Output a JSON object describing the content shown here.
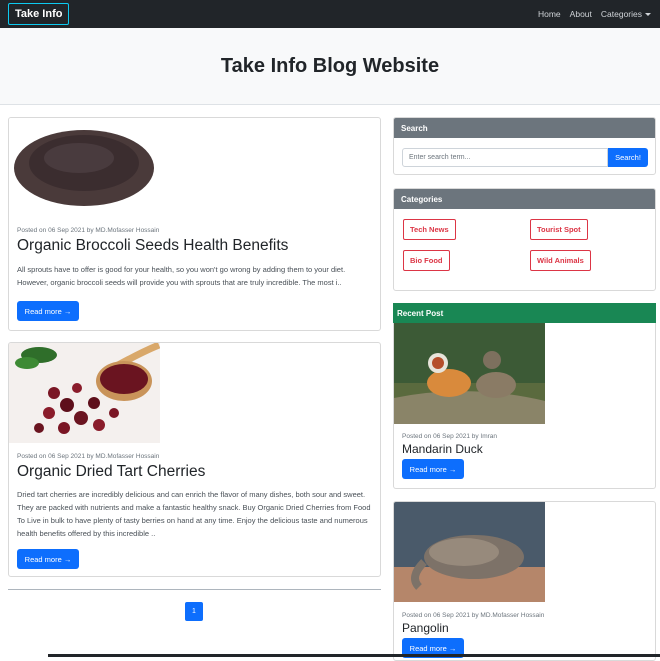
{
  "nav": {
    "brand": "Take Info",
    "home": "Home",
    "about": "About",
    "categories": "Categories"
  },
  "hero": {
    "title": "Take Info Blog Website"
  },
  "posts": [
    {
      "meta": "Posted on 06 Sep 2021 by MD.Mofasser Hossain",
      "title": "Organic Broccoli Seeds Health Benefits",
      "excerpt": "All sprouts have to offer is good for your health, so you won't go wrong by adding them to your diet. However, organic broccoli seeds will provide you with sprouts that are truly incredible. The most i..",
      "button": "Read more →"
    },
    {
      "meta": "Posted on 06 Sep 2021 by MD.Mofasser Hossain",
      "title": "Organic Dried Tart Cherries",
      "excerpt": "Dried tart cherries are incredibly delicious and can enrich the flavor of many dishes, both sour and sweet. They are packed with nutrients and make a fantastic healthy snack. Buy Organic Dried Cherries from Food To Live in bulk to have plenty of tasty berries on hand at any time. Enjoy the delicious taste and numerous health benefits offered by this incredible ..",
      "button": "Read more →"
    }
  ],
  "pagination": {
    "current": "1"
  },
  "search": {
    "header": "Search",
    "placeholder": "Enter search term...",
    "button": "Search!"
  },
  "categories": {
    "header": "Categories",
    "items": [
      "Tech News",
      "Tourist Spot",
      "Bio Food",
      "Wild Animals"
    ]
  },
  "recent": {
    "header": "Recent Post",
    "items": [
      {
        "meta": "Posted on 06 Sep 2021 by Imran",
        "title": "Mandarin Duck",
        "button": "Read more →"
      },
      {
        "meta": "Posted on 06 Sep 2021 by MD.Mofasser Hossain",
        "title": "Pangolin",
        "button": "Read more →"
      }
    ]
  },
  "colors": {
    "nav": "#212529",
    "primary": "#0d6efd",
    "danger": "#dc3545",
    "sidebar_header": "#6c757d",
    "recent_header": "#198754"
  }
}
